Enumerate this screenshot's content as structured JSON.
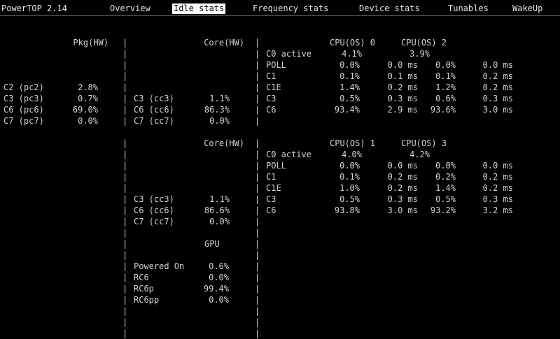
{
  "app_title": "PowerTOP 2.14",
  "tabs": [
    {
      "label": "Overview"
    },
    {
      "label": "Idle stats",
      "active": true
    },
    {
      "label": "Frequency stats"
    },
    {
      "label": "Device stats"
    },
    {
      "label": "Tunables"
    },
    {
      "label": "WakeUp"
    }
  ],
  "pkg": {
    "header": "Pkg(HW)",
    "rows": [
      {
        "label": "C2 (pc2)",
        "value": "2.8%"
      },
      {
        "label": "C3 (pc3)",
        "value": "0.7%"
      },
      {
        "label": "C6 (pc6)",
        "value": "69.0%"
      },
      {
        "label": "C7 (pc7)",
        "value": "0.0%"
      }
    ]
  },
  "core_blocks": [
    {
      "header": "Core(HW)",
      "rows": [
        {
          "label": "C3 (cc3)",
          "value": "1.1%"
        },
        {
          "label": "C6 (cc6)",
          "value": "86.3%"
        },
        {
          "label": "C7 (cc7)",
          "value": "0.0%"
        }
      ]
    },
    {
      "header": "Core(HW)",
      "rows": [
        {
          "label": "C3 (cc3)",
          "value": "1.1%"
        },
        {
          "label": "C6 (cc6)",
          "value": "86.6%"
        },
        {
          "label": "C7 (cc7)",
          "value": "0.0%"
        }
      ]
    }
  ],
  "cpu_blocks": [
    {
      "cpu_a": "CPU(OS) 0",
      "cpu_b": "CPU(OS) 2",
      "c0_label": "C0 active",
      "c0_a": "4.1%",
      "c0_b": "3.9%",
      "rows": [
        {
          "label": "POLL",
          "pct_a": "0.0%",
          "time_a": "0.0 ms",
          "pct_b": "0.0%",
          "time_b": "0.0 ms"
        },
        {
          "label": "C1",
          "pct_a": "0.1%",
          "time_a": "0.1 ms",
          "pct_b": "0.1%",
          "time_b": "0.2 ms"
        },
        {
          "label": "C1E",
          "pct_a": "1.4%",
          "time_a": "0.2 ms",
          "pct_b": "1.2%",
          "time_b": "0.2 ms"
        },
        {
          "label": "C3",
          "pct_a": "0.5%",
          "time_a": "0.3 ms",
          "pct_b": "0.6%",
          "time_b": "0.3 ms"
        },
        {
          "label": "C6",
          "pct_a": "93.4%",
          "time_a": "2.9 ms",
          "pct_b": "93.6%",
          "time_b": "3.0 ms"
        }
      ]
    },
    {
      "cpu_a": "CPU(OS) 1",
      "cpu_b": "CPU(OS) 3",
      "c0_label": "C0 active",
      "c0_a": "4.0%",
      "c0_b": "4.2%",
      "rows": [
        {
          "label": "POLL",
          "pct_a": "0.0%",
          "time_a": "0.0 ms",
          "pct_b": "0.0%",
          "time_b": "0.0 ms"
        },
        {
          "label": "C1",
          "pct_a": "0.1%",
          "time_a": "0.2 ms",
          "pct_b": "0.2%",
          "time_b": "0.2 ms"
        },
        {
          "label": "C1E",
          "pct_a": "1.0%",
          "time_a": "0.2 ms",
          "pct_b": "1.4%",
          "time_b": "0.2 ms"
        },
        {
          "label": "C3",
          "pct_a": "0.5%",
          "time_a": "0.3 ms",
          "pct_b": "0.5%",
          "time_b": "0.3 ms"
        },
        {
          "label": "C6",
          "pct_a": "93.8%",
          "time_a": "3.0 ms",
          "pct_b": "93.2%",
          "time_b": "3.2 ms"
        }
      ]
    }
  ],
  "gpu": {
    "header": "GPU",
    "rows": [
      {
        "label": "Powered On",
        "value": "0.6%"
      },
      {
        "label": "RC6",
        "value": "0.0%"
      },
      {
        "label": "RC6p",
        "value": "99.4%"
      },
      {
        "label": "RC6pp",
        "value": "0.0%"
      }
    ]
  },
  "separator": "|",
  "colors": {
    "background": "#000000",
    "text": "#d2d2d2",
    "active_tab_bg": "#ffffff",
    "active_tab_fg": "#000000"
  }
}
